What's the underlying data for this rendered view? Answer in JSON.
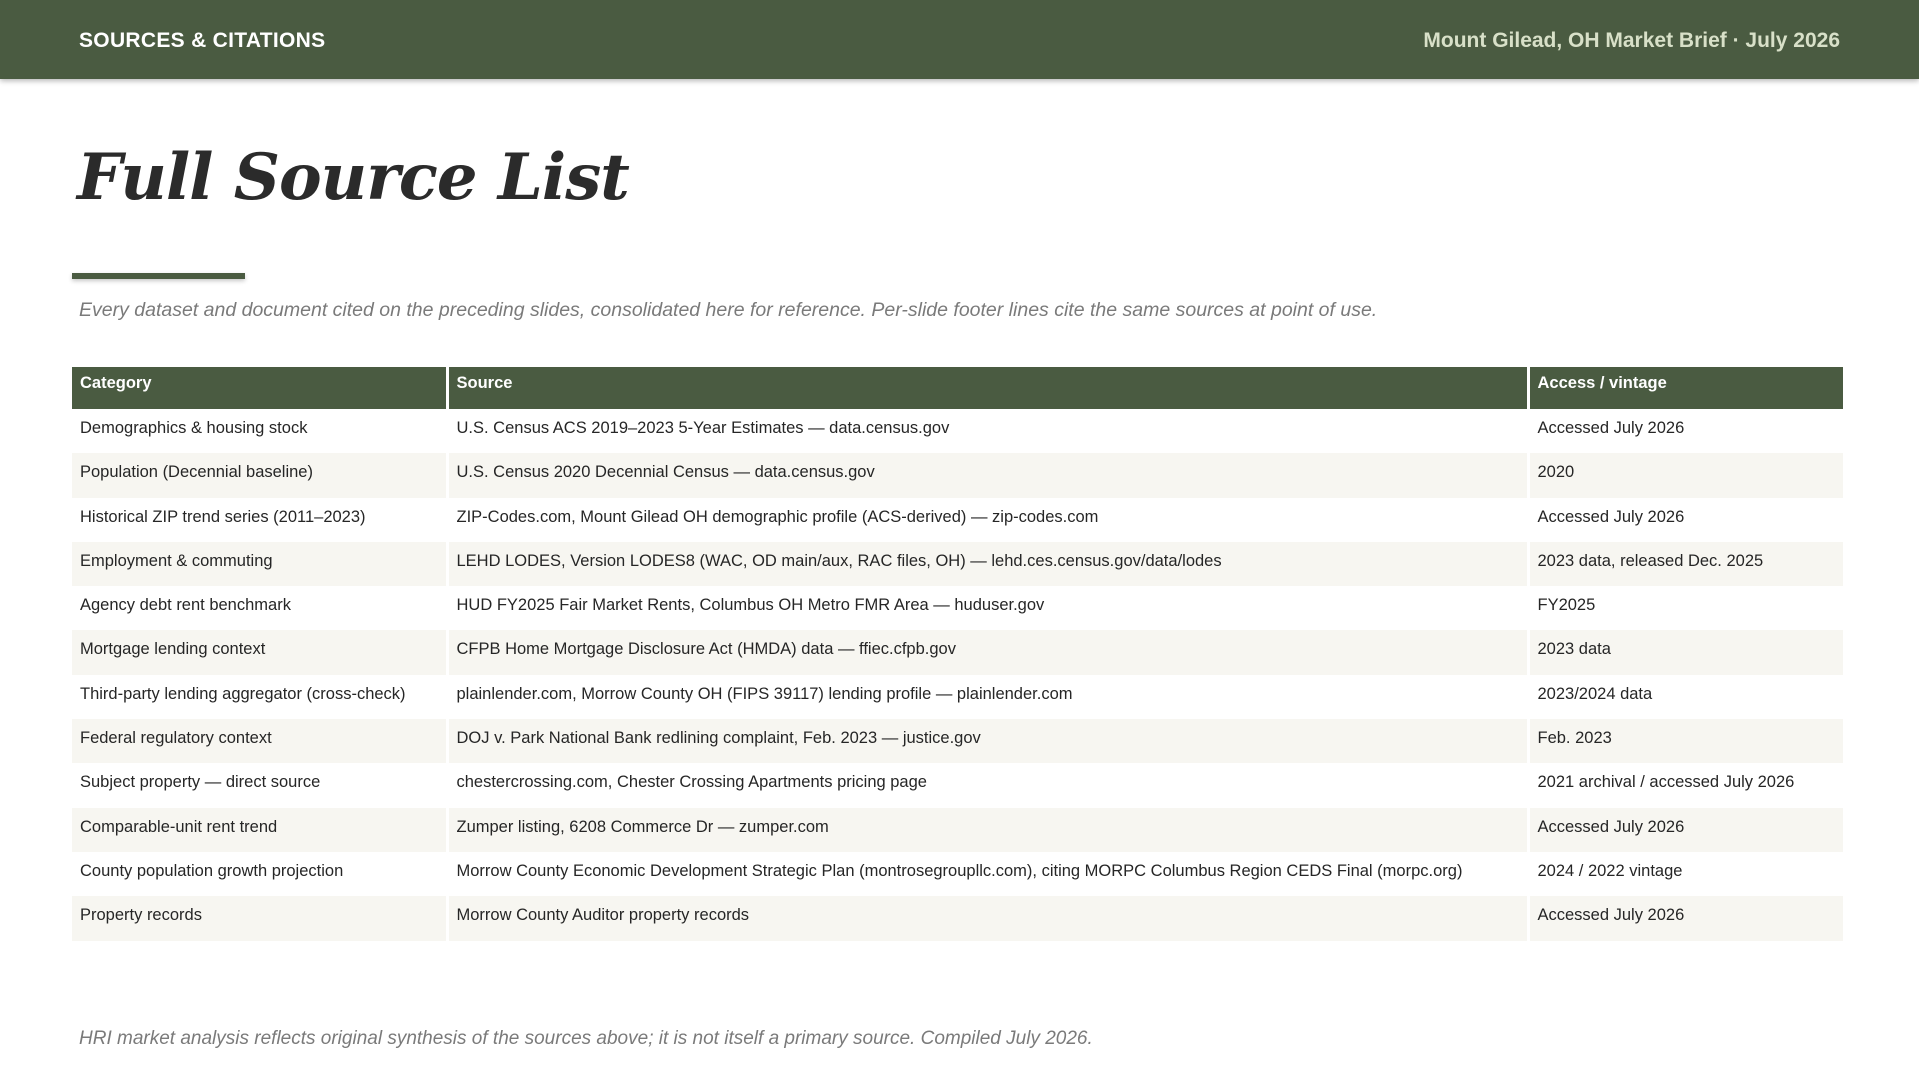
{
  "header": {
    "section_label": "SOURCES & CITATIONS",
    "brief_title": "Mount Gilead, OH Market Brief · July 2026"
  },
  "page": {
    "title": "Full Source List",
    "subtitle": "Every dataset and document cited on the preceding slides, consolidated here for reference. Per-slide footer lines cite the same sources at point of use.",
    "footnote": "HRI market analysis reflects original synthesis of the sources above; it is not itself a primary source. Compiled July 2026."
  },
  "colors": {
    "header_bg": "#4a5b41",
    "header_right_text": "#d8e0c8",
    "row_stripe": "#f7f6f1"
  },
  "table": {
    "columns": [
      "Category",
      "Source",
      "Access / vintage"
    ],
    "rows": [
      [
        "Demographics & housing stock",
        "U.S. Census ACS 2019–2023 5-Year Estimates — data.census.gov",
        "Accessed July 2026"
      ],
      [
        "Population (Decennial baseline)",
        "U.S. Census 2020 Decennial Census — data.census.gov",
        "2020"
      ],
      [
        "Historical ZIP trend series (2011–2023)",
        "ZIP-Codes.com, Mount Gilead OH demographic profile (ACS-derived) — zip-codes.com",
        "Accessed July 2026"
      ],
      [
        "Employment & commuting",
        "LEHD LODES, Version LODES8 (WAC, OD main/aux, RAC files, OH) — lehd.ces.census.gov/data/lodes",
        "2023 data, released Dec. 2025"
      ],
      [
        "Agency debt rent benchmark",
        "HUD FY2025 Fair Market Rents, Columbus OH Metro FMR Area — huduser.gov",
        "FY2025"
      ],
      [
        "Mortgage lending context",
        "CFPB Home Mortgage Disclosure Act (HMDA) data — ffiec.cfpb.gov",
        "2023 data"
      ],
      [
        "Third-party lending aggregator (cross-check)",
        "plainlender.com, Morrow County OH (FIPS 39117) lending profile — plainlender.com",
        "2023/2024 data"
      ],
      [
        "Federal regulatory context",
        "DOJ v. Park National Bank redlining complaint, Feb. 2023 — justice.gov",
        "Feb. 2023"
      ],
      [
        "Subject property — direct source",
        "chestercrossing.com, Chester Crossing Apartments pricing page",
        "2021 archival / accessed July 2026"
      ],
      [
        "Comparable-unit rent trend",
        "Zumper listing, 6208 Commerce Dr — zumper.com",
        "Accessed July 2026"
      ],
      [
        "County population growth projection",
        "Morrow County Economic Development Strategic Plan (montrosegroupllc.com), citing MORPC Columbus Region CEDS Final (morpc.org)",
        "2024 / 2022 vintage"
      ],
      [
        "Property records",
        "Morrow County Auditor property records",
        "Accessed July 2026"
      ]
    ]
  }
}
